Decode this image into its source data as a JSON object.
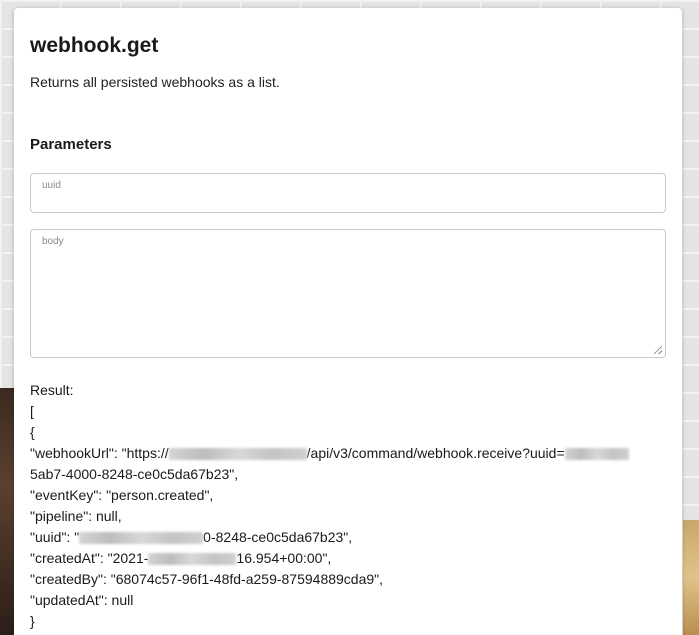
{
  "doc": {
    "title": "webhook.get",
    "description": "Returns all persisted webhooks as a list.",
    "parameters_heading": "Parameters"
  },
  "params": {
    "uuid_label": "uuid",
    "uuid_value": "",
    "body_label": "body",
    "body_value": ""
  },
  "result": {
    "label": "Result:",
    "open_bracket": "[",
    "open_brace": "{",
    "webhookUrl_key": "\"webhookUrl\": \"https://",
    "webhookUrl_mid": "/api/v3/command/webhook.receive?uuid=",
    "webhookUrl_tail": "5ab7-4000-8248-ce0c5da67b23\",",
    "eventKey": "\"eventKey\": \"person.created\",",
    "pipeline": "\"pipeline\": null,",
    "uuid_key": "\"uuid\": \"",
    "uuid_tail": "0-8248-ce0c5da67b23\",",
    "createdAt_key": "\"createdAt\": \"2021-",
    "createdAt_tail": "16.954+00:00\",",
    "createdBy": "\"createdBy\": \"68074c57-96f1-48fd-a259-87594889cda9\",",
    "updatedAt": "\"updatedAt\": null",
    "close_brace": "}"
  }
}
